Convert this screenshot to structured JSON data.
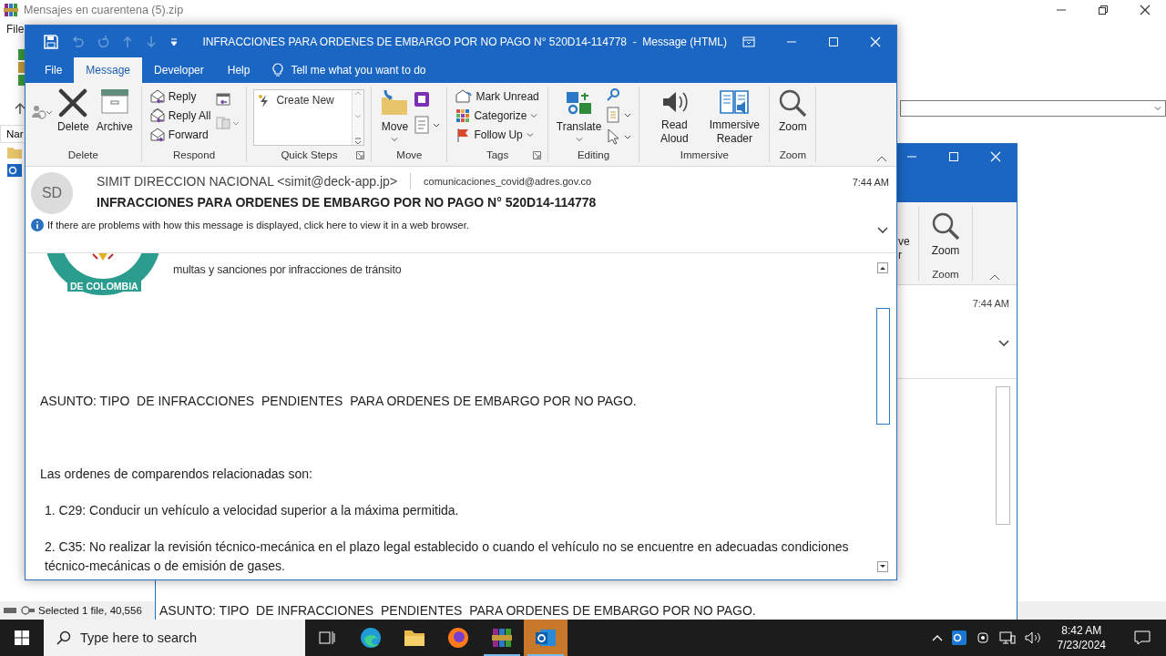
{
  "archive_window": {
    "title": "Mensajes en cuarentena (5).zip",
    "menu": [
      "File"
    ],
    "column_1": "Nar",
    "status": "Selected 1 file, 40,556"
  },
  "back_window": {
    "ribbon_fragments": [
      "ve",
      "r"
    ],
    "zoom_button": "Zoom",
    "zoom_group": "Zoom",
    "time": "7:44 AM",
    "body_text": "ASUNTO: TIPO  DE INFRACCIONES  PENDIENTES  PARA ORDENES DE EMBARGO POR NO PAGO."
  },
  "message_window": {
    "title": "INFRACCIONES PARA ORDENES DE EMBARGO POR NO PAGO N° 520D14-114778  -  Message (HTML)",
    "tabs": [
      {
        "label": "File",
        "selected": false
      },
      {
        "label": "Message",
        "selected": true
      },
      {
        "label": "Developer",
        "selected": false
      },
      {
        "label": "Help",
        "selected": false
      }
    ],
    "tell_me": "Tell me what you want to do",
    "ribbon_groups": [
      {
        "label": "Delete",
        "items": [
          {
            "kind": "large",
            "label": "Delete"
          },
          {
            "kind": "large",
            "label": "Archive"
          }
        ]
      },
      {
        "label": "Respond",
        "items": [
          {
            "kind": "small",
            "label": "Reply"
          },
          {
            "kind": "small",
            "label": "Reply All"
          },
          {
            "kind": "small",
            "label": "Forward"
          }
        ]
      },
      {
        "label": "Quick Steps",
        "launcher": true,
        "items": [
          {
            "kind": "gallery",
            "label": "Create New"
          }
        ]
      },
      {
        "label": "Move",
        "items": [
          {
            "kind": "large",
            "label": "Move",
            "dropdown": true
          }
        ]
      },
      {
        "label": "Tags",
        "launcher": true,
        "items": [
          {
            "kind": "small",
            "label": "Mark Unread"
          },
          {
            "kind": "small",
            "label": "Categorize",
            "dropdown": true
          },
          {
            "kind": "small",
            "label": "Follow Up",
            "dropdown": true
          }
        ]
      },
      {
        "label": "Editing",
        "items": [
          {
            "kind": "large",
            "label": "Translate",
            "dropdown": true
          }
        ]
      },
      {
        "label": "Immersive",
        "items": [
          {
            "kind": "large",
            "label": "Read Aloud"
          },
          {
            "kind": "large",
            "label": "Immersive Reader"
          }
        ]
      },
      {
        "label": "Zoom",
        "items": [
          {
            "kind": "large",
            "label": "Zoom"
          }
        ]
      }
    ],
    "header": {
      "initials": "SD",
      "sender": "SIMIT DIRECCION NACIONAL <simit@deck-app.jp>",
      "to": "comunicaciones_covid@adres.gov.co",
      "time": "7:44 AM",
      "subject": "INFRACCIONES PARA ORDENES DE EMBARGO POR NO PAGO N° 520D14-114778",
      "info": "If there are problems with how this message is displayed, click here to view it in a web browser."
    },
    "body": {
      "emblem_text": "DE COLOMBIA",
      "tagline": "multas y sanciones por infracciones de tránsito",
      "paragraphs": [
        {
          "kind": "subject",
          "text": "ASUNTO: TIPO  DE INFRACCIONES  PENDIENTES  PARA ORDENES DE EMBARGO POR NO PAGO."
        },
        {
          "kind": "text",
          "text": "Las ordenes de comparendos relacionadas son:"
        },
        {
          "kind": "item",
          "text": "1. C29: Conducir un vehículo a velocidad superior a la máxima permitida."
        },
        {
          "kind": "item",
          "text": "2. C35: No realizar la revisión técnico-mecánica en el plazo legal establecido o cuando el vehículo no se encuentre en adecuadas condiciones técnico-mecánicas o de emisión de gases."
        }
      ]
    }
  },
  "taskbar": {
    "search_placeholder": "Type here to search",
    "apps": [
      {
        "kind": "browser",
        "flashing": false
      },
      {
        "kind": "folder",
        "flashing": false
      },
      {
        "kind": "firefox",
        "flashing": false
      },
      {
        "kind": "archiver",
        "open": true,
        "flashing": false
      },
      {
        "kind": "mail",
        "open": true,
        "flashing": true
      }
    ],
    "time": "8:42 AM",
    "date": "7/23/2024"
  }
}
